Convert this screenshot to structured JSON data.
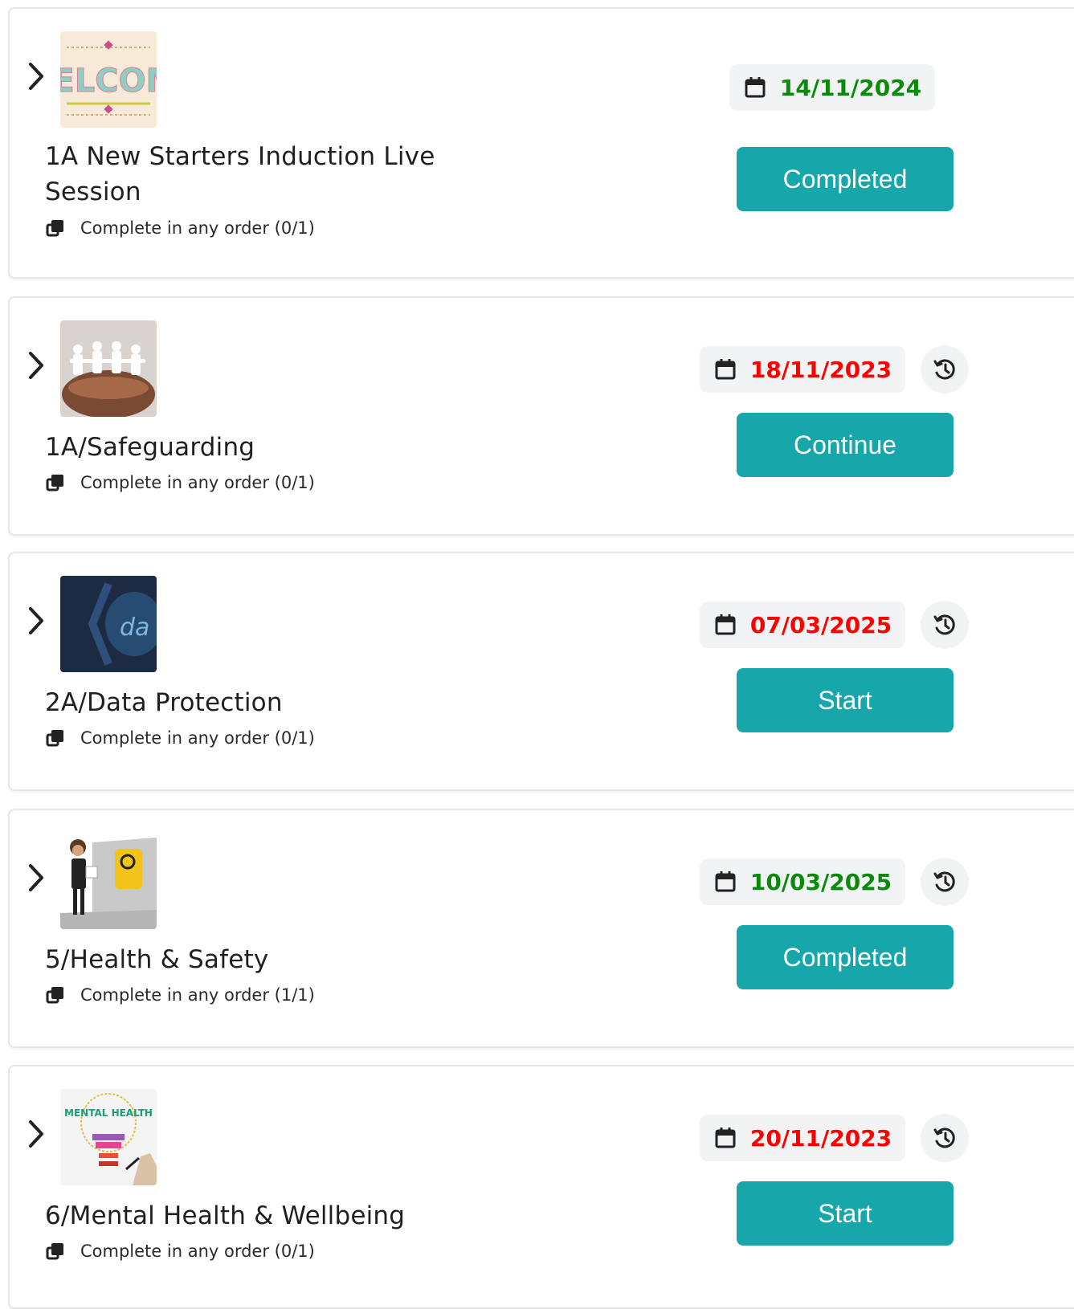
{
  "courses": [
    {
      "title": "1A New Starters Induction Live Session",
      "order_text": "Complete in any order (0/1)",
      "date": "14/11/2024",
      "date_color": "#0a8a0a",
      "has_history": false,
      "action_label": "Completed",
      "thumbnail": "welcome-image",
      "thumbnail_text": "WELCOME"
    },
    {
      "title": "1A/Safeguarding",
      "order_text": "Complete in any order (0/1)",
      "date": "18/11/2023",
      "date_color": "#ff0000",
      "has_history": true,
      "action_label": "Continue",
      "thumbnail": "paper-chain-people-in-hands-image"
    },
    {
      "title": "2A/Data Protection",
      "order_text": "Complete in any order (0/1)",
      "date": "07/03/2025",
      "date_color": "#ff0000",
      "has_history": true,
      "action_label": "Start",
      "thumbnail": "data-protection-image",
      "thumbnail_text": "da"
    },
    {
      "title": "5/Health & Safety",
      "order_text": "Complete in any order (1/1)",
      "date": "10/03/2025",
      "date_color": "#0a8a0a",
      "has_history": true,
      "action_label": "Completed",
      "thumbnail": "health-and-safety-image"
    },
    {
      "title": "6/Mental Health & Wellbeing",
      "order_text": "Complete in any order (0/1)",
      "date": "20/11/2023",
      "date_color": "#ff0000",
      "has_history": true,
      "action_label": "Start",
      "thumbnail": "mental-health-bulb-image",
      "thumbnail_text": "MENTAL HEALTH"
    }
  ],
  "colors": {
    "action_button": "#17a6a9",
    "pill_background": "#f1f3f5"
  }
}
